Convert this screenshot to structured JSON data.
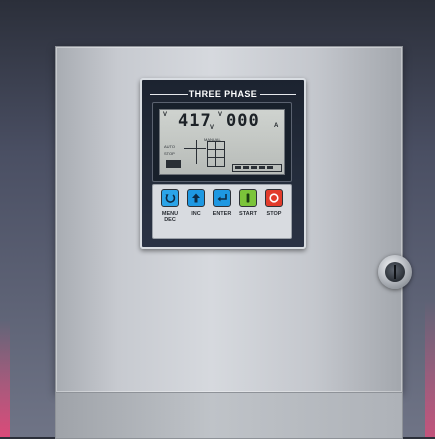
{
  "controller": {
    "title": "THREE PHASE",
    "display": {
      "voltage": "417",
      "current": "000",
      "unit_voltage": "V",
      "unit_current": "A",
      "tiny_auto": "AUTO",
      "tiny_stop": "STOP",
      "tiny_manual": "MANUAL"
    },
    "buttons": [
      {
        "label": "MENU",
        "sub_label": "DEC",
        "icon": "undo-arrow-icon",
        "color": "#2ba4e8"
      },
      {
        "label": "INC",
        "icon": "up-arrow-icon",
        "color": "#1e98e2"
      },
      {
        "label": "ENTER",
        "icon": "enter-arrow-icon",
        "color": "#1e98e2"
      },
      {
        "label": "START",
        "icon": "start-bar-icon",
        "color": "#7bc43a"
      },
      {
        "label": "STOP",
        "icon": "stop-circle-icon",
        "color": "#e23b2b"
      }
    ]
  },
  "colors": {
    "background_top": "#2b2f3a",
    "enclosure": "#d6d9de",
    "lcd": "#cfd3cf",
    "accent_pink": "#e6467a"
  }
}
